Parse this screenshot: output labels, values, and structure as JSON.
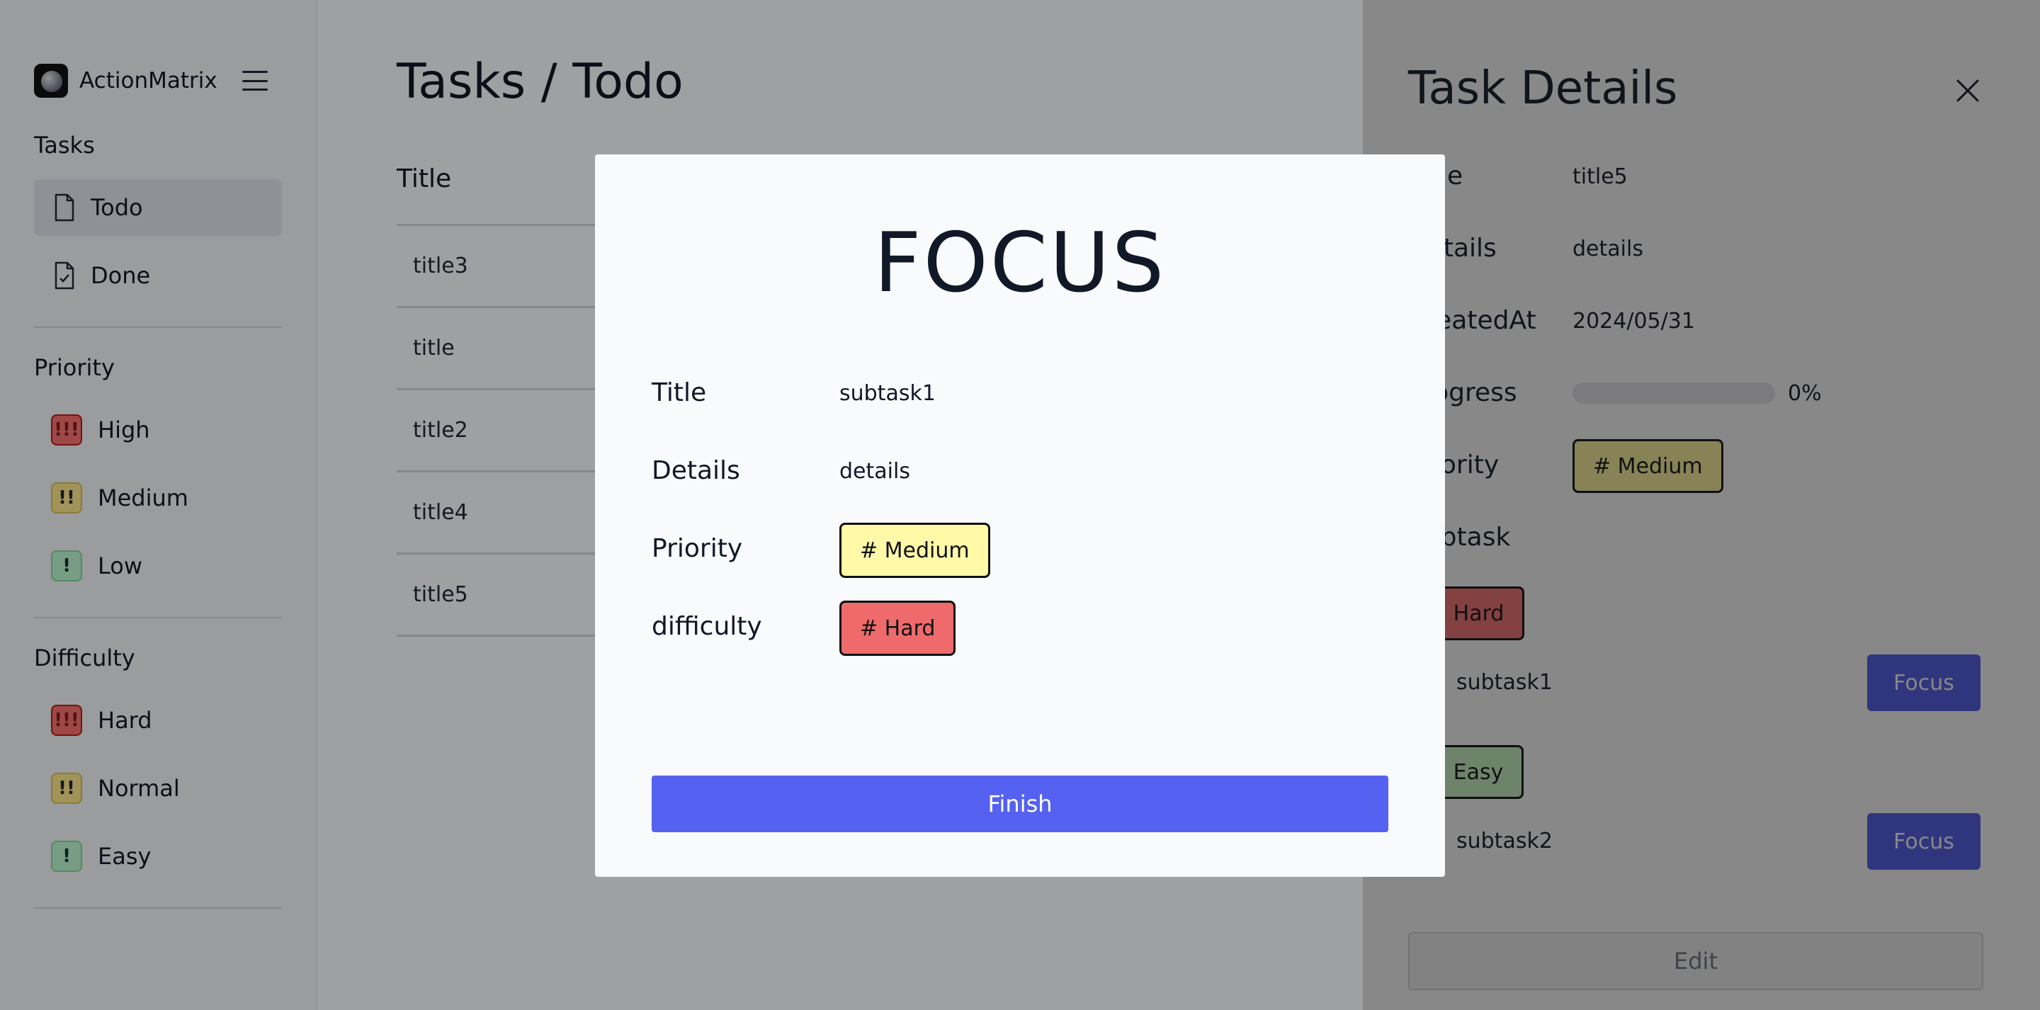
{
  "sidebar": {
    "brand": "ActionMatrix",
    "tasks_title": "Tasks",
    "tasks_items": [
      {
        "label": "Todo",
        "icon": "file-icon"
      },
      {
        "label": "Done",
        "icon": "file-check-icon"
      }
    ],
    "priority_title": "Priority",
    "priority_items": [
      {
        "label": "High",
        "badge": "!!!"
      },
      {
        "label": "Medium",
        "badge": "!!"
      },
      {
        "label": "Low",
        "badge": "!"
      }
    ],
    "difficulty_title": "Difficulty",
    "difficulty_items": [
      {
        "label": "Hard",
        "badge": "!!!"
      },
      {
        "label": "Normal",
        "badge": "!!"
      },
      {
        "label": "Easy",
        "badge": "!"
      }
    ]
  },
  "main": {
    "title": "Tasks / Todo",
    "column_header": "Title",
    "rows": [
      "title3",
      "title",
      "title2",
      "title4",
      "title5"
    ]
  },
  "details": {
    "title": "Task Details",
    "labels": {
      "title": "Title",
      "details": "Details",
      "created": "CreatedAt",
      "progress": "Progress",
      "priority": "Priority",
      "subtask": "Subtask"
    },
    "values": {
      "title": "title5",
      "details": "details",
      "created": "2024/05/31",
      "progress": "0%",
      "priority": "# Medium"
    },
    "progress_fraction": 0,
    "subtasks": [
      {
        "difficulty": "# Hard",
        "name": "subtask1",
        "action": "Focus"
      },
      {
        "difficulty": "# Easy",
        "name": "subtask2",
        "action": "Focus"
      }
    ],
    "edit_label": "Edit"
  },
  "modal": {
    "title": "FOCUS",
    "labels": {
      "title": "Title",
      "details": "Details",
      "priority": "Priority",
      "difficulty": "difficulty"
    },
    "values": {
      "title": "subtask1",
      "details": "details",
      "priority": "# Medium",
      "difficulty": "# Hard"
    },
    "finish_label": "Finish"
  },
  "colors": {
    "accent": "#5561f0",
    "tag_medium": "#fff9a8",
    "tag_hard": "#ef6b6b",
    "tag_easy": "#c8f7c5"
  }
}
